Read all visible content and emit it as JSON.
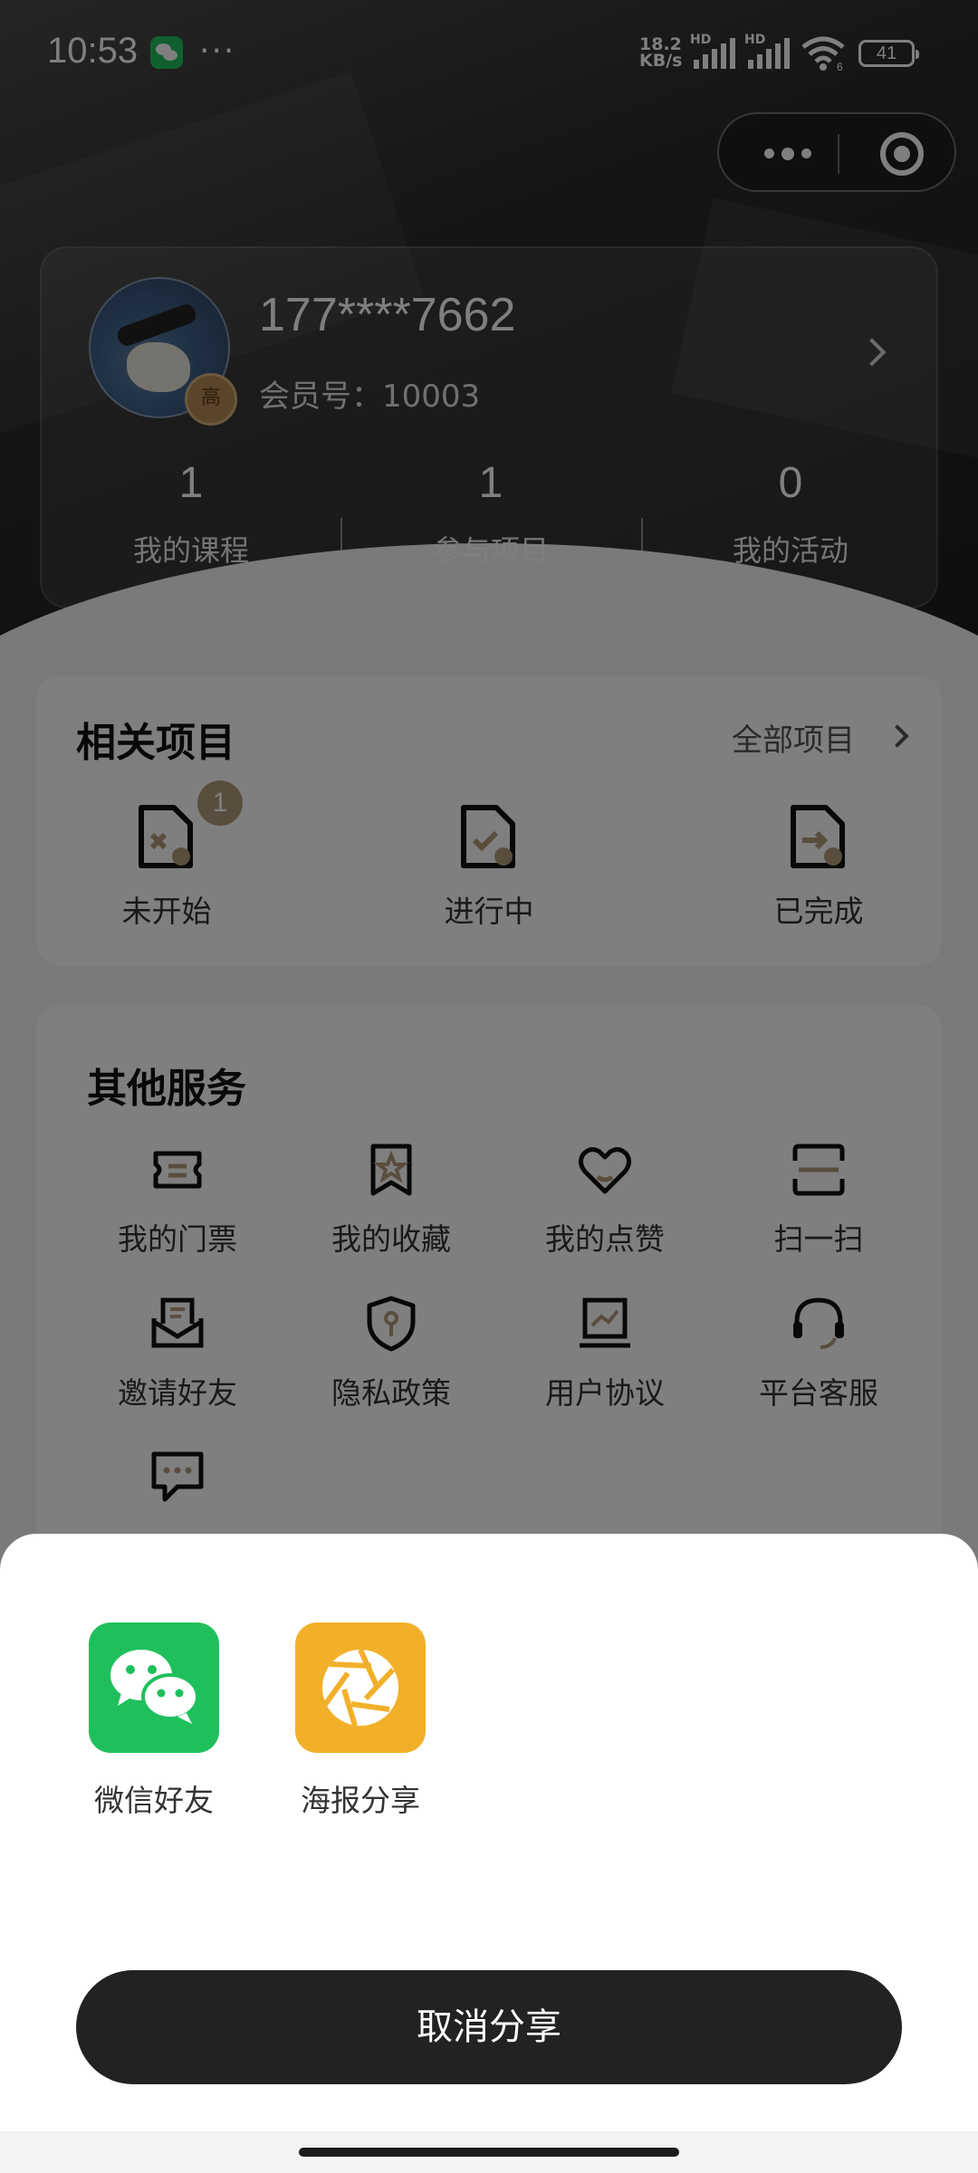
{
  "status_bar": {
    "time": "10:53",
    "more_dots": "···",
    "net_speed_value": "18.2",
    "net_speed_unit": "KB/s",
    "hd_label": "HD",
    "wifi_suffix": "6",
    "battery": "41"
  },
  "profile": {
    "phone": "177****7662",
    "member_label": "会员号：",
    "member_id": "10003",
    "level_badge": "高",
    "stats": [
      {
        "value": "1",
        "label": "我的课程"
      },
      {
        "value": "1",
        "label": "参与项目"
      },
      {
        "value": "0",
        "label": "我的活动"
      }
    ]
  },
  "projects": {
    "title": "相关项目",
    "more_label": "全部项目",
    "items": [
      {
        "label": "未开始",
        "count": "1",
        "icon": "file-x-icon"
      },
      {
        "label": "进行中",
        "icon": "file-check-icon"
      },
      {
        "label": "已完成",
        "icon": "file-arrow-icon"
      }
    ]
  },
  "services": {
    "title": "其他服务",
    "items": [
      {
        "label": "我的门票",
        "icon": "ticket-icon"
      },
      {
        "label": "我的收藏",
        "icon": "bookmark-star-icon"
      },
      {
        "label": "我的点赞",
        "icon": "heart-icon"
      },
      {
        "label": "扫一扫",
        "icon": "scan-icon"
      },
      {
        "label": "邀请好友",
        "icon": "invite-icon"
      },
      {
        "label": "隐私政策",
        "icon": "shield-key-icon"
      },
      {
        "label": "用户协议",
        "icon": "monitor-chart-icon"
      },
      {
        "label": "平台客服",
        "icon": "headset-icon"
      },
      {
        "label": "",
        "icon": "message-icon"
      }
    ]
  },
  "share_sheet": {
    "options": [
      {
        "label": "微信好友",
        "icon": "wechat-icon",
        "color": "#1fc05c"
      },
      {
        "label": "海报分享",
        "icon": "aperture-icon",
        "color": "#f2b02a"
      }
    ],
    "cancel_label": "取消分享"
  },
  "colors": {
    "accent_gold": "#b39b7c",
    "button_dark": "#222222",
    "wechat_green": "#1fc05c",
    "poster_orange": "#f2b02a"
  }
}
